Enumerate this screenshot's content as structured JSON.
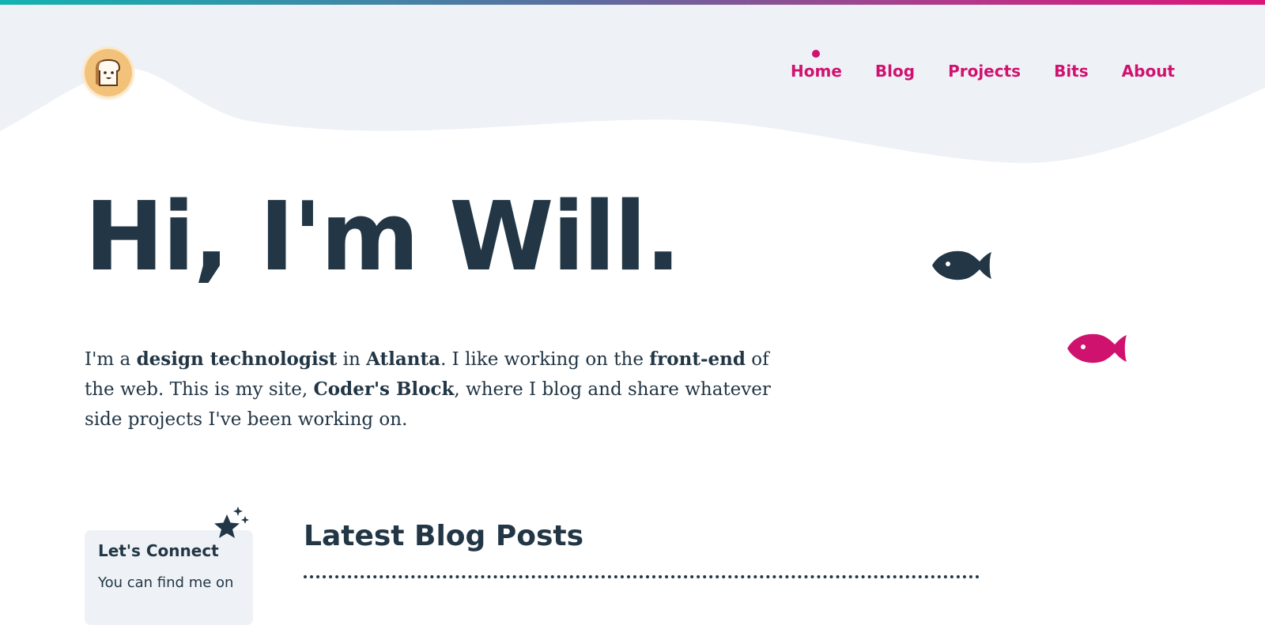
{
  "colors": {
    "accent": "#d0126f",
    "text": "#223645",
    "wave": "#eef2f6",
    "logo_bg": "#f3c27a"
  },
  "header": {
    "logo_icon": "toast-icon",
    "nav": [
      {
        "label": "Home",
        "active": true
      },
      {
        "label": "Blog",
        "active": false
      },
      {
        "label": "Projects",
        "active": false
      },
      {
        "label": "Bits",
        "active": false
      },
      {
        "label": "About",
        "active": false
      }
    ]
  },
  "hero": {
    "title": "Hi, I'm Will.",
    "intro": {
      "p1": "I'm a ",
      "b1": "design technologist",
      "p2": " in ",
      "b2": "Atlanta",
      "p3": ". I like working on the ",
      "b3": "front-end",
      "p4": " of the web. This is my site, ",
      "b4": "Coder's Block",
      "p5": ", where I blog and share whatever side projects I've been working on."
    },
    "decor_icons": [
      "fish-icon",
      "fish-icon",
      "sparkle-star-icon"
    ]
  },
  "connect": {
    "title": "Let's Connect",
    "text": "You can find me on"
  },
  "latest_posts": {
    "title": "Latest Blog Posts"
  }
}
